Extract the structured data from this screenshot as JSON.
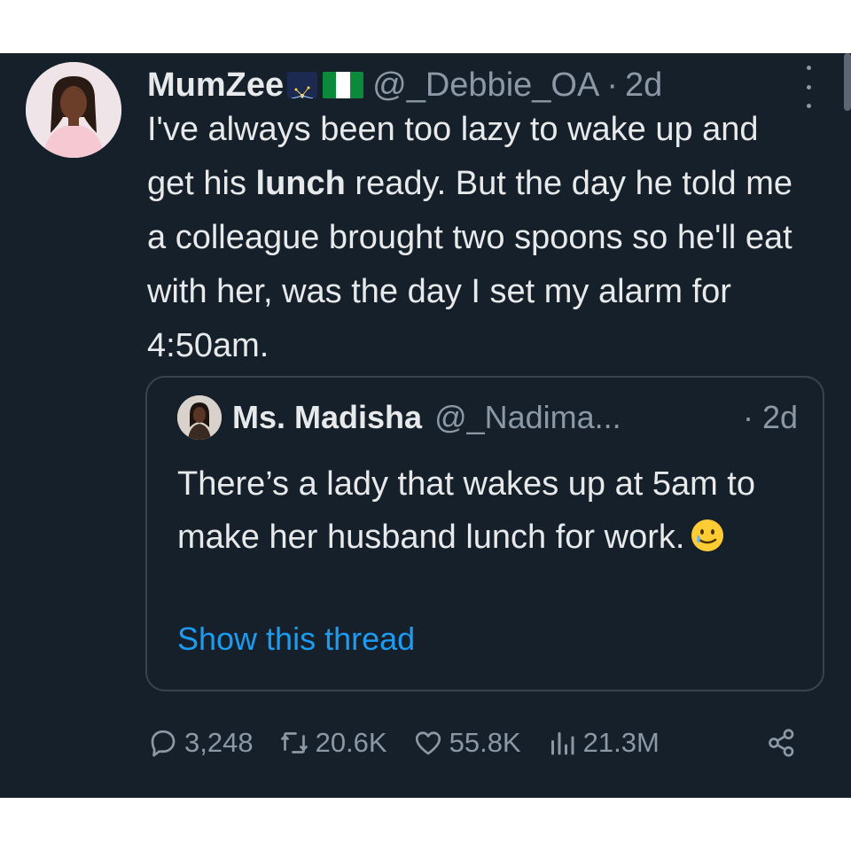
{
  "tweet": {
    "display_name": "MumZee",
    "badges": [
      "fireworks-emoji",
      "nigeria-flag-emoji"
    ],
    "handle": "@_Debbie_OA",
    "separator": "·",
    "time": "2d",
    "text_parts": [
      "I've always been too lazy to wake up and get his ",
      "lunch",
      " ready. But the day he told me a colleague brought two spoons so he'll eat with her, was the day I set my alarm for 4:50am."
    ]
  },
  "quote": {
    "display_name": "Ms. Madisha",
    "handle": "@_Nadima...",
    "time": "· 2d",
    "text": "There’s a lady that wakes up at 5am to make her husband lunch for work.",
    "emoji": "smiling-face-with-tear-emoji",
    "show_thread": "Show this thread"
  },
  "actions": {
    "replies": "3,248",
    "retweets": "20.6K",
    "likes": "55.8K",
    "views": "21.3M",
    "icons": [
      "reply-icon",
      "retweet-icon",
      "like-icon",
      "views-icon",
      "share-icon"
    ]
  },
  "colors": {
    "background": "#15202b",
    "text": "#e7e9ea",
    "muted": "#8b98a5",
    "link": "#1d9bf0",
    "border": "#38444d"
  }
}
